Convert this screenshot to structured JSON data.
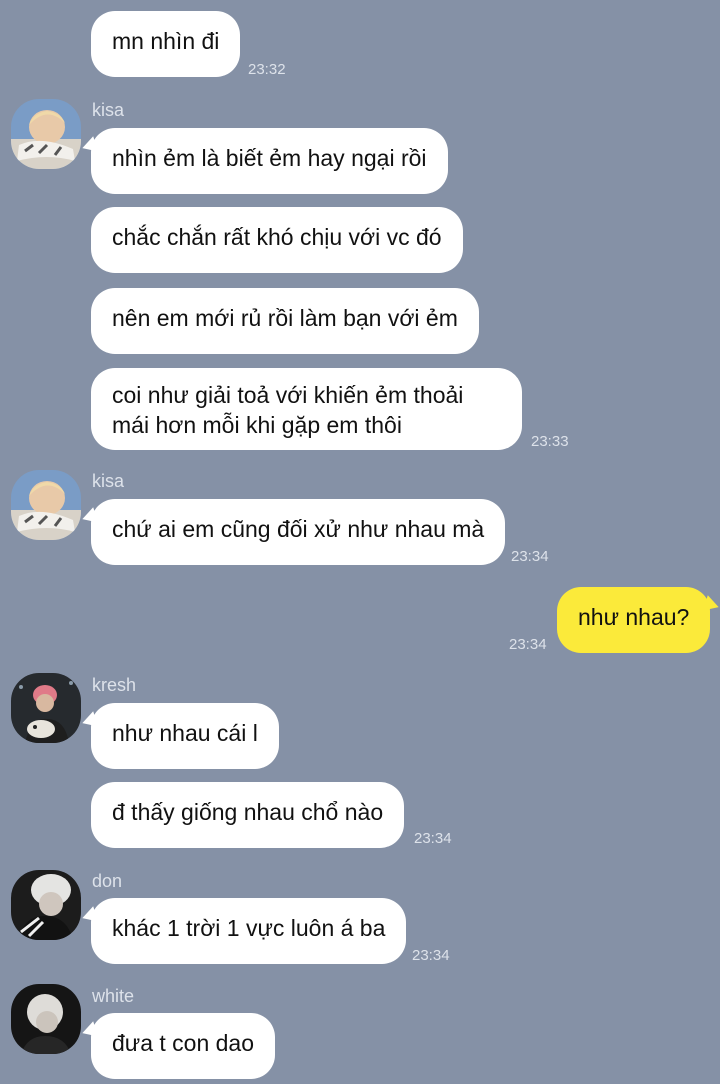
{
  "messages": [
    {
      "text": "mn nhìn đi",
      "time": "23:32"
    },
    {
      "sender": "kisa",
      "text": "nhìn ẻm là biết ẻm hay ngại rồi"
    },
    {
      "text": "chắc chắn rất khó chịu với vc đó"
    },
    {
      "text": "nên em mới rủ rồi làm bạn với ẻm"
    },
    {
      "text": "coi như giải toả với khiến ẻm thoải mái hơn mỗi khi gặp em thôi",
      "time": "23:33"
    },
    {
      "sender": "kisa",
      "text": "chứ ai em cũng đối xử như nhau mà",
      "time": "23:34"
    },
    {
      "text": "như nhau?",
      "time": "23:34",
      "mine": true
    },
    {
      "sender": "kresh",
      "text": "như nhau cái l"
    },
    {
      "text": "đ thấy giống nhau chổ nào",
      "time": "23:34"
    },
    {
      "sender": "don",
      "text": "khác 1 trời 1 vực luôn á ba",
      "time": "23:34"
    },
    {
      "sender": "white",
      "text": "đưa t con dao"
    }
  ],
  "avatars": {
    "kisa": "avatar-kisa",
    "kresh": "avatar-kresh",
    "don": "avatar-don",
    "white": "avatar-white"
  },
  "colors": {
    "background": "#8591a6",
    "incoming_bubble": "#ffffff",
    "outgoing_bubble": "#fbea3a"
  }
}
